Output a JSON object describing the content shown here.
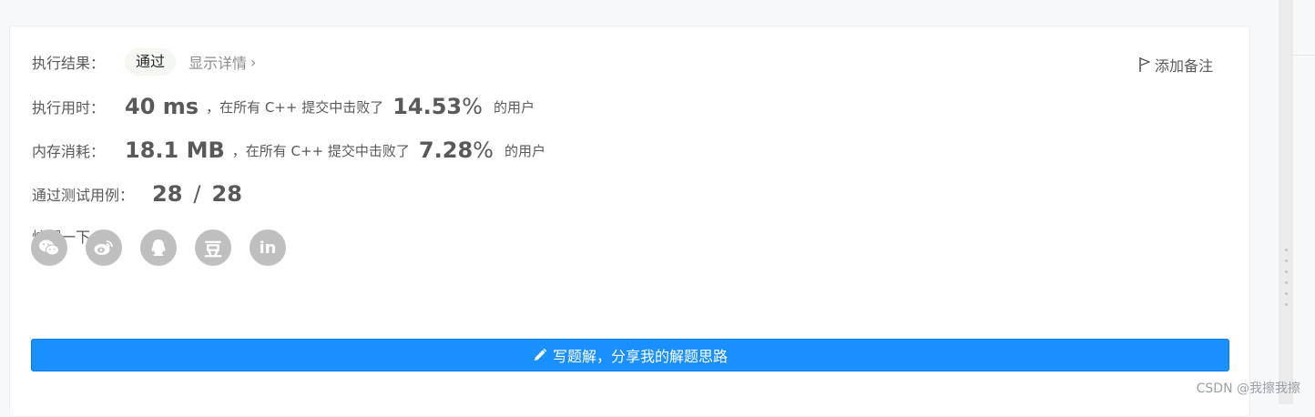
{
  "result": {
    "label": "执行结果：",
    "status": "通过",
    "details_link": "显示详情",
    "details_chevron": "›",
    "add_note": "添加备注"
  },
  "runtime": {
    "label": "执行用时：",
    "value": "40 ms",
    "text": "，在所有 C++ 提交中击败了",
    "percent": "14.53",
    "percent_unit": "%",
    "suffix": "的用户"
  },
  "memory": {
    "label": "内存消耗：",
    "value": "18.1 MB",
    "text": "，在所有 C++ 提交中击败了",
    "percent": "7.28",
    "percent_unit": "%",
    "suffix": "的用户"
  },
  "tests": {
    "label": "通过测试用例：",
    "passed": "28",
    "separator": "/",
    "total": "28"
  },
  "share": {
    "label": "炫耀一下:",
    "icons": [
      "wechat-icon",
      "weibo-icon",
      "qq-icon",
      "douban-icon",
      "linkedin-icon"
    ],
    "douban_glyph": "豆",
    "linkedin_glyph": "in"
  },
  "write_solution": {
    "label": "写题解，分享我的解题思路"
  },
  "watermark": "CSDN @我擦我擦",
  "colors": {
    "primary": "#1a90ff",
    "icon_gray": "#bfbfbf",
    "pill_bg": "#f5f7f3"
  }
}
